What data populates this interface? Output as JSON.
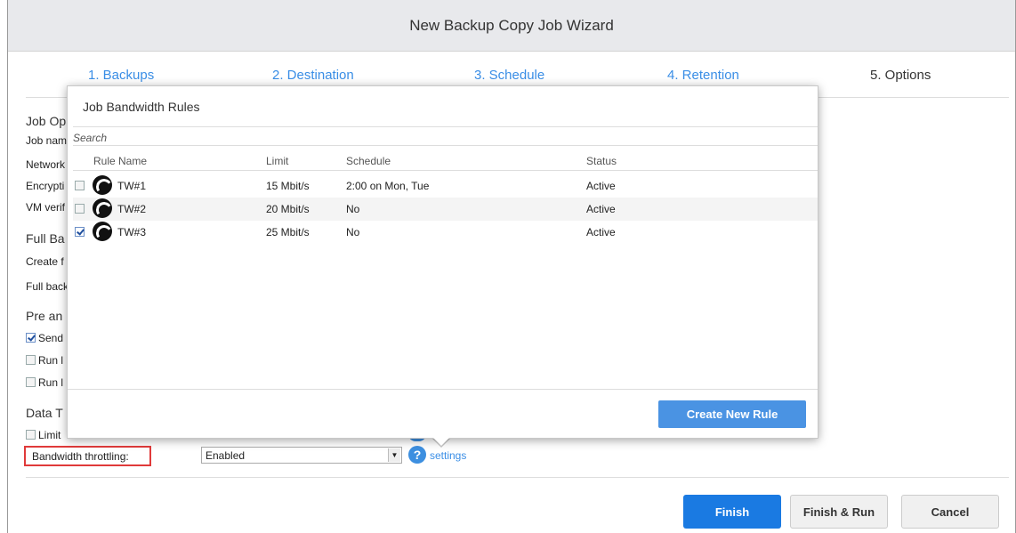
{
  "window": {
    "title": "New Backup Copy Job Wizard"
  },
  "steps": [
    {
      "label": "1. Backups"
    },
    {
      "label": "2. Destination"
    },
    {
      "label": "3. Schedule"
    },
    {
      "label": "4. Retention"
    },
    {
      "label": "5. Options"
    }
  ],
  "background": {
    "job_options_heading": "Job Op",
    "job_name_label": "Job nam",
    "network_label": "Network",
    "encryption_label": "Encrypti",
    "vm_verif_label": "VM verif",
    "full_backup_heading": "Full Ba",
    "create_full_label": "Create f",
    "full_backup_label": "Full back",
    "pre_post_heading": "Pre an",
    "send_label": "Send",
    "run1_label": "Run l",
    "run2_label": "Run l",
    "data_transfer_heading": "Data T",
    "limit_label": "Limit",
    "bandwidth_label": "Bandwidth throttling:",
    "bandwidth_value": "Enabled",
    "settings_link": "settings"
  },
  "popup": {
    "title": "Job Bandwidth Rules",
    "search_placeholder": "Search",
    "columns": {
      "rule_name": "Rule Name",
      "limit": "Limit",
      "schedule": "Schedule",
      "status": "Status"
    },
    "rows": [
      {
        "name": "TW#1",
        "limit": "15 Mbit/s",
        "schedule": "2:00 on Mon, Tue",
        "status": "Active",
        "checked": false
      },
      {
        "name": "TW#2",
        "limit": "20 Mbit/s",
        "schedule": "No",
        "status": "Active",
        "checked": false
      },
      {
        "name": "TW#3",
        "limit": "25 Mbit/s",
        "schedule": "No",
        "status": "Active",
        "checked": true
      }
    ],
    "create_button": "Create New Rule"
  },
  "footer": {
    "finish": "Finish",
    "finish_run": "Finish & Run",
    "cancel": "Cancel"
  },
  "colors": {
    "accent": "#1a7ae2",
    "link": "#3a8ee6",
    "highlight": "#e03a3a"
  }
}
